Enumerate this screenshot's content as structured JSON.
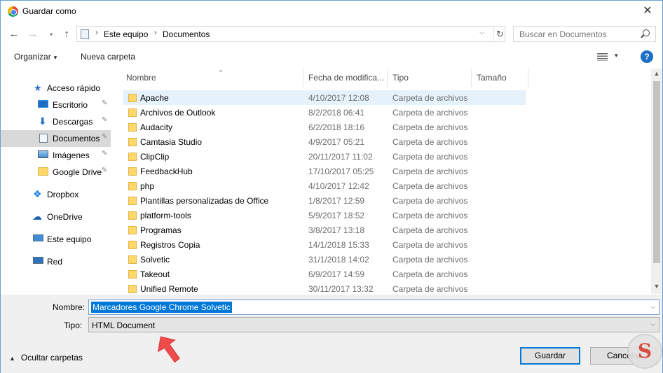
{
  "window": {
    "title": "Guardar como",
    "close_glyph": "✕"
  },
  "nav": {
    "back_glyph": "←",
    "forward_glyph": "→",
    "recent_glyph": "▾",
    "up_glyph": "↑",
    "address": [
      "Este equipo",
      "Documentos"
    ],
    "address_sep": "›",
    "dropdown_glyph": "⌵",
    "refresh_glyph": "↻",
    "search_placeholder": "Buscar en Documentos"
  },
  "toolbar": {
    "organize": "Organizar",
    "new_folder": "Nueva carpeta",
    "caret": "▾",
    "help": "?"
  },
  "sidebar": {
    "pin_glyph": "✎",
    "items": [
      {
        "label": "Acceso rápido",
        "icon": "star-icon"
      },
      {
        "label": "Escritorio",
        "icon": "desktop-icon",
        "pinned": true
      },
      {
        "label": "Descargas",
        "icon": "download-icon",
        "pinned": true
      },
      {
        "label": "Documentos",
        "icon": "document-icon",
        "pinned": true,
        "selected": true
      },
      {
        "label": "Imágenes",
        "icon": "image-icon",
        "pinned": true
      },
      {
        "label": "Google Drive",
        "icon": "folder-icon",
        "pinned": true
      },
      {
        "label": "Dropbox",
        "icon": "dropbox-icon"
      },
      {
        "label": "OneDrive",
        "icon": "cloud-icon"
      },
      {
        "label": "Este equipo",
        "icon": "computer-icon"
      },
      {
        "label": "Red",
        "icon": "network-icon"
      }
    ]
  },
  "columns": {
    "name": "Nombre",
    "date": "Fecha de modifica...",
    "type": "Tipo",
    "size": "Tamaño",
    "sort_glyph": "^"
  },
  "files": [
    {
      "name": "Apache",
      "date": "4/10/2017 12:08",
      "type": "Carpeta de archivos"
    },
    {
      "name": "Archivos de Outlook",
      "date": "8/2/2018 06:41",
      "type": "Carpeta de archivos"
    },
    {
      "name": "Audacity",
      "date": "6/2/2018 18:16",
      "type": "Carpeta de archivos"
    },
    {
      "name": "Camtasia Studio",
      "date": "4/9/2017 05:21",
      "type": "Carpeta de archivos"
    },
    {
      "name": "ClipClip",
      "date": "20/11/2017 11:02",
      "type": "Carpeta de archivos"
    },
    {
      "name": "FeedbackHub",
      "date": "17/10/2017 05:25",
      "type": "Carpeta de archivos"
    },
    {
      "name": "php",
      "date": "4/10/2017 12:42",
      "type": "Carpeta de archivos"
    },
    {
      "name": "Plantillas personalizadas de Office",
      "date": "1/8/2017 12:59",
      "type": "Carpeta de archivos"
    },
    {
      "name": "platform-tools",
      "date": "5/9/2017 18:52",
      "type": "Carpeta de archivos"
    },
    {
      "name": "Programas",
      "date": "3/8/2017 13:18",
      "type": "Carpeta de archivos"
    },
    {
      "name": "Registros Copia",
      "date": "14/1/2018 15:33",
      "type": "Carpeta de archivos"
    },
    {
      "name": "Solvetic",
      "date": "31/1/2018 14:02",
      "type": "Carpeta de archivos"
    },
    {
      "name": "Takeout",
      "date": "6/9/2017 14:59",
      "type": "Carpeta de archivos"
    },
    {
      "name": "Unified Remote",
      "date": "30/11/2017 13:32",
      "type": "Carpeta de archivos"
    }
  ],
  "scroll": {
    "up_glyph": "▲",
    "down_glyph": "▼"
  },
  "form": {
    "name_label": "Nombre:",
    "name_value": "Marcadores Google Chrome Solvetic",
    "type_label": "Tipo:",
    "type_value": "HTML Document",
    "dropdown_glyph": "⌵"
  },
  "footer": {
    "hide_folders": "Ocultar carpetas",
    "hide_caret": "▲",
    "save": "Guardar",
    "cancel": "Cancelar"
  },
  "colors": {
    "accent": "#0078d7",
    "selection": "#e5f1fb",
    "folder": "#ffd86b",
    "arrow": "#f04b4b"
  }
}
